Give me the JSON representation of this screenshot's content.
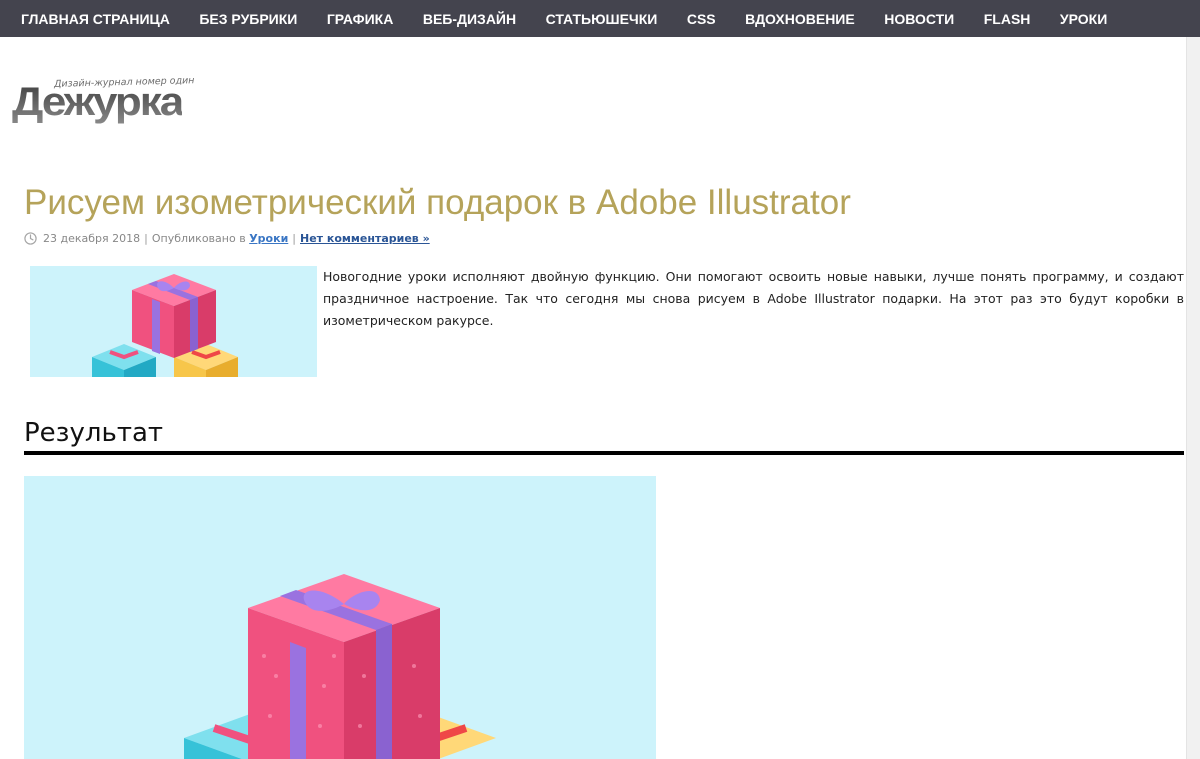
{
  "nav": {
    "items": [
      "ГЛАВНАЯ СТРАНИЦА",
      "БЕЗ РУБРИКИ",
      "ГРАФИКА",
      "ВЕБ-ДИЗАЙН",
      "СТАТЬЮШЕЧКИ",
      "CSS",
      "ВДОХНОВЕНИЕ",
      "НОВОСТИ",
      "FLASH",
      "УРОКИ"
    ]
  },
  "logo": {
    "tagline": "Дизайн-журнал номер один",
    "text": "Дежурка"
  },
  "post": {
    "title": "Рисуем изометрический подарок в Adobe Illustrator",
    "date": "23 декабря 2018",
    "sep1": "|",
    "published_in": "Опубликовано в",
    "category": "Уроки",
    "sep2": "|",
    "comments": "Нет комментариев »",
    "intro": "Новогодние уроки исполняют двойную функцию. Они помогают освоить новые навыки, лучше понять программу, и создают праздничное настроение. Так что сегодня мы снова рисуем в Adobe Illustrator подарки. На этот раз это будут коробки в изометрическом ракурсе.",
    "section_heading": "Результат"
  },
  "colors": {
    "nav_bg": "#44444e",
    "title": "#b5a35a",
    "link": "#3a76c4",
    "image_bg": "#cdf3fb",
    "gift_pink": "#f0517f",
    "gift_ribbon": "#9a72e0",
    "gift_blue": "#3ec8dc",
    "gift_yellow": "#f7c64a"
  }
}
